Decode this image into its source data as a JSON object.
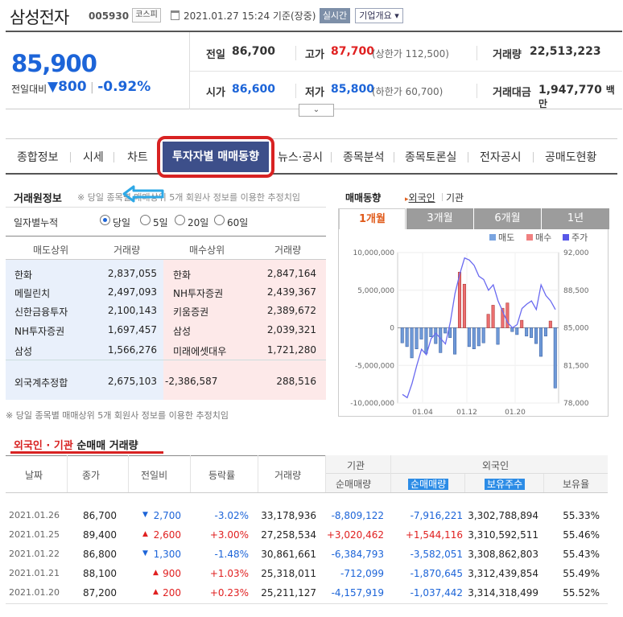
{
  "header": {
    "name": "삼성전자",
    "code": "005930",
    "market": "코스피",
    "datetime": "2021.01.27 15:24 기준(장중)",
    "realtime": "실시간",
    "company_btn": "기업개요 ▾"
  },
  "quote": {
    "price": "85,900",
    "change_label": "전일대비",
    "change_arrow": "▼",
    "change": "800",
    "change_pct": "-0.92%",
    "items": [
      {
        "label": "전일",
        "value": "86,700",
        "sub": ""
      },
      {
        "label": "고가",
        "value": "87,700",
        "sub": "(상한가 112,500)"
      },
      {
        "label": "거래량",
        "value": "22,513,223",
        "sub": ""
      },
      {
        "label": "시가",
        "value": "86,600",
        "sub": ""
      },
      {
        "label": "저가",
        "value": "85,800",
        "sub": "(하한가 60,700)"
      },
      {
        "label": "거래대금",
        "value": "1,947,770",
        "sub": "백만"
      }
    ]
  },
  "tabs": [
    "종합정보",
    "시세",
    "차트",
    "투자자별 매매동향",
    "뉴스·공시",
    "종목분석",
    "종목토론실",
    "전자공시",
    "공매도현황"
  ],
  "broker": {
    "title": "거래원정보",
    "note": "※ 당일 종목별 매매상위 5개 회원사 정보를 이용한 추정치임",
    "daily_label": "일자별누적",
    "periods": [
      "당일",
      "5일",
      "20일",
      "60일"
    ],
    "headers": [
      "매도상위",
      "거래량",
      "매수상위",
      "거래량"
    ],
    "sell": [
      [
        "한화",
        "2,837,055"
      ],
      [
        "메릴린치",
        "2,497,093"
      ],
      [
        "신한금융투자",
        "2,100,143"
      ],
      [
        "NH투자증권",
        "1,697,457"
      ],
      [
        "삼성",
        "1,566,276"
      ]
    ],
    "buy": [
      [
        "한화",
        "2,847,164"
      ],
      [
        "NH투자증권",
        "2,439,367"
      ],
      [
        "키움증권",
        "2,389,672"
      ],
      [
        "삼성",
        "2,039,321"
      ],
      [
        "미래에셋대우",
        "1,721,280"
      ]
    ],
    "foreign": {
      "label": "외국계추정합",
      "sell": "2,675,103",
      "buy": "-2,386,587",
      "net": "288,516"
    }
  },
  "chart_panel": {
    "title": "매매동향",
    "opt1": "외국인",
    "opt2": "기관",
    "periods": [
      "1개월",
      "3개월",
      "6개월",
      "1년"
    ]
  },
  "chart_data": {
    "type": "bar",
    "legend": [
      "매도",
      "매수",
      "주가"
    ],
    "x_ticks": [
      "01.04",
      "01.12",
      "01.20"
    ],
    "y_left": [
      "10,000,000",
      "5,000,000",
      "0",
      "-5,000,000",
      "-10,000,000"
    ],
    "y_right": [
      "92,000",
      "88,500",
      "85,000",
      "81,500",
      "78,000"
    ],
    "ylim_left": [
      -10000000,
      10000000
    ],
    "ylim_right": [
      78000,
      92000
    ],
    "bars": [
      -2000000,
      -2500000,
      -4000000,
      -2800000,
      -1500000,
      -3400000,
      -1200000,
      -2100000,
      -3300000,
      -700000,
      -1300000,
      -3500000,
      7400000,
      5800000,
      -2500000,
      -2800000,
      -2400000,
      -2000000,
      1800000,
      3000000,
      -2200000,
      2600000,
      3300000,
      -500000,
      -900000,
      1000000,
      -1100000,
      -1300000,
      -2100000,
      -3800000,
      -1100000,
      900000,
      -8000000
    ],
    "price": [
      78800,
      78500,
      79800,
      81500,
      83000,
      82500,
      84000,
      84500,
      84000,
      83500,
      85500,
      88200,
      90000,
      91500,
      91300,
      90800,
      89800,
      89500,
      88500,
      89000,
      87500,
      86500,
      85500,
      85000,
      85300,
      86800,
      87200,
      87500,
      86700,
      89000,
      88000,
      87500,
      86700
    ]
  },
  "flow": {
    "title_a": "외국인 · 기관",
    "title_b": " 순매매 거래량",
    "headers": {
      "date": "날짜",
      "close": "종가",
      "diff": "전일비",
      "rate": "등락률",
      "volume": "거래량",
      "inst": "기관",
      "inst_net": "순매매량",
      "foreign": "외국인",
      "f_net": "순매매량",
      "f_hold": "보유주수",
      "f_rate": "보유율"
    },
    "rows": [
      {
        "date": "2021.01.26",
        "close": "86,700",
        "dir": "down",
        "diff": "2,700",
        "rate": "-3.02%",
        "vol": "33,178,936",
        "inst": "-8,809,122",
        "fnet": "-7,916,221",
        "hold": "3,302,788,894",
        "hrate": "55.33%"
      },
      {
        "date": "2021.01.25",
        "close": "89,400",
        "dir": "up",
        "diff": "2,600",
        "rate": "+3.00%",
        "vol": "27,258,534",
        "inst": "+3,020,462",
        "fnet": "+1,544,116",
        "hold": "3,310,592,511",
        "hrate": "55.46%"
      },
      {
        "date": "2021.01.22",
        "close": "86,800",
        "dir": "down",
        "diff": "1,300",
        "rate": "-1.48%",
        "vol": "30,861,661",
        "inst": "-6,384,793",
        "fnet": "-3,582,051",
        "hold": "3,308,862,803",
        "hrate": "55.43%"
      },
      {
        "date": "2021.01.21",
        "close": "88,100",
        "dir": "up",
        "diff": "900",
        "rate": "+1.03%",
        "vol": "25,318,011",
        "inst": "-712,099",
        "fnet": "-1,870,645",
        "hold": "3,312,439,854",
        "hrate": "55.49%"
      },
      {
        "date": "2021.01.20",
        "close": "87,200",
        "dir": "up",
        "diff": "200",
        "rate": "+0.23%",
        "vol": "25,211,127",
        "inst": "-4,157,919",
        "fnet": "-1,037,442",
        "hold": "3,314,318,499",
        "hrate": "55.52%"
      }
    ]
  }
}
